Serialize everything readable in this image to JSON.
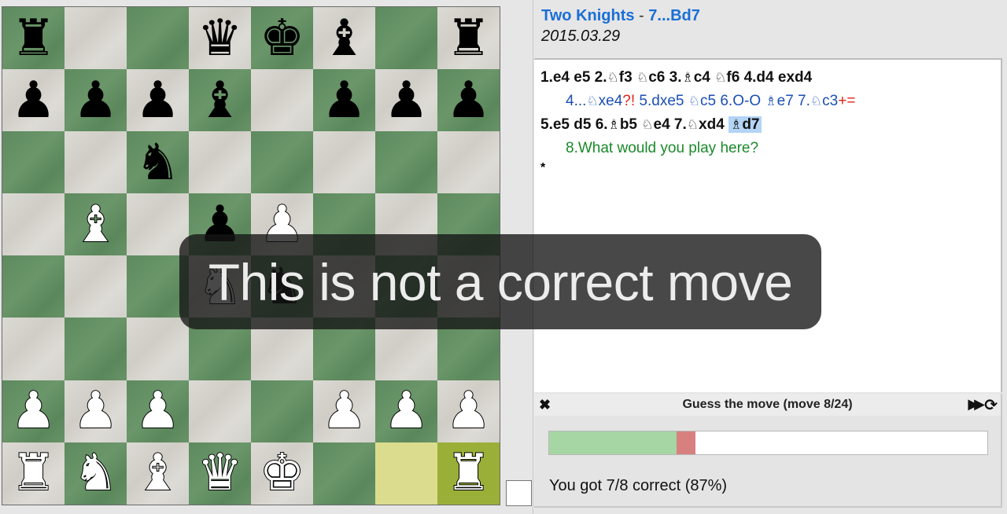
{
  "game": {
    "title": "Two Knights",
    "separator": " - ",
    "current_move": "7...Bd7",
    "date": "2015.03.29"
  },
  "board": {
    "colors": {
      "light": "#d8d6d0",
      "dark": "#5f8c60",
      "highlight_dark": "#9aaf38",
      "highlight_light": "#dcdc8e"
    },
    "highlighted_squares": [
      "g1",
      "h1"
    ],
    "pieces": [
      {
        "sq": "a8",
        "piece": "r"
      },
      {
        "sq": "d8",
        "piece": "q"
      },
      {
        "sq": "e8",
        "piece": "k"
      },
      {
        "sq": "f8",
        "piece": "b"
      },
      {
        "sq": "h8",
        "piece": "r"
      },
      {
        "sq": "a7",
        "piece": "p"
      },
      {
        "sq": "b7",
        "piece": "p"
      },
      {
        "sq": "c7",
        "piece": "p"
      },
      {
        "sq": "d7",
        "piece": "b"
      },
      {
        "sq": "f7",
        "piece": "p"
      },
      {
        "sq": "g7",
        "piece": "p"
      },
      {
        "sq": "h7",
        "piece": "p"
      },
      {
        "sq": "c6",
        "piece": "n"
      },
      {
        "sq": "b5",
        "piece": "B"
      },
      {
        "sq": "d5",
        "piece": "p"
      },
      {
        "sq": "e5",
        "piece": "P"
      },
      {
        "sq": "d4",
        "piece": "N"
      },
      {
        "sq": "e4",
        "piece": "n"
      },
      {
        "sq": "a2",
        "piece": "P"
      },
      {
        "sq": "b2",
        "piece": "P"
      },
      {
        "sq": "c2",
        "piece": "P"
      },
      {
        "sq": "f2",
        "piece": "P"
      },
      {
        "sq": "g2",
        "piece": "P"
      },
      {
        "sq": "h2",
        "piece": "P"
      },
      {
        "sq": "a1",
        "piece": "R"
      },
      {
        "sq": "b1",
        "piece": "N"
      },
      {
        "sq": "c1",
        "piece": "B"
      },
      {
        "sq": "d1",
        "piece": "Q"
      },
      {
        "sq": "e1",
        "piece": "K"
      },
      {
        "sq": "h1",
        "piece": "R"
      }
    ],
    "side_to_move": "white"
  },
  "notation": {
    "line1": [
      {
        "t": "1.e4 e5 2."
      },
      {
        "fig": "♘"
      },
      {
        "t": "f3 "
      },
      {
        "fig": "♘"
      },
      {
        "t": "c6 3."
      },
      {
        "fig": "♗"
      },
      {
        "t": "c4 "
      },
      {
        "fig": "♘"
      },
      {
        "t": "f6 4.d4 exd4"
      }
    ],
    "variation": [
      {
        "t": "4..."
      },
      {
        "fig": "♘"
      },
      {
        "t": "xe4"
      },
      {
        "nag": "?!"
      },
      {
        "t": " 5.dxe5 "
      },
      {
        "fig": "♘"
      },
      {
        "t": "c5 6.O-O "
      },
      {
        "fig": "♗"
      },
      {
        "t": "e7 7."
      },
      {
        "fig": "♘"
      },
      {
        "t": "c3"
      },
      {
        "nag": "+="
      }
    ],
    "line2": [
      {
        "t": "5.e5 d5 6."
      },
      {
        "fig": "♗"
      },
      {
        "t": "b5 "
      },
      {
        "fig": "♘"
      },
      {
        "t": "e4 7."
      },
      {
        "fig": "♘"
      },
      {
        "t": "xd4 "
      },
      {
        "cur_fig": "♗",
        "cur_t": "d7"
      }
    ],
    "comment": "8.What would you play here?",
    "result": "*"
  },
  "guess": {
    "header": "Guess the move (move 8/24)",
    "close_icon": "✖",
    "fast_forward_icon": "▶▶",
    "refresh_icon": "⟳",
    "progress": {
      "total": 24,
      "correct": 7,
      "wrong": 1,
      "correct_color": "#a5d6a3",
      "wrong_color": "#d88080"
    },
    "score_text": "You got 7/8 correct (87%)"
  },
  "toast": {
    "message": "This is not a correct move"
  }
}
